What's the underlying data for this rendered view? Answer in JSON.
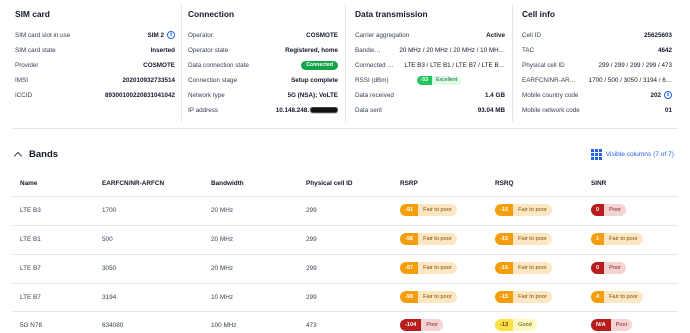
{
  "sim_card": {
    "title": "SIM card",
    "rows": [
      {
        "label": "SIM card slot in use",
        "value": "SIM 2"
      },
      {
        "label": "SIM card state",
        "value": "Inserted"
      },
      {
        "label": "Provider",
        "value": "COSMOTE"
      },
      {
        "label": "IMSI",
        "value": "202010932733514"
      },
      {
        "label": "ICCID",
        "value": "89300100220831041042"
      }
    ]
  },
  "connection": {
    "title": "Connection",
    "rows": [
      {
        "label": "Operator",
        "value": "COSMOTE"
      },
      {
        "label": "Operator state",
        "value": "Registered, home"
      },
      {
        "label": "Data connection state",
        "value": "Connected"
      },
      {
        "label": "Connection stage",
        "value": "Setup complete"
      },
      {
        "label": "Network type",
        "value": "5G (NSA); VoLTE"
      },
      {
        "label": "IP address",
        "value": "10.148.248."
      }
    ]
  },
  "data_transmission": {
    "title": "Data transmission",
    "rows": [
      {
        "label": "Carrier aggregation",
        "value": "Active"
      },
      {
        "label": "Bandw…",
        "value": "20 MHz / 20 MHz / 20 MHz / 10 MH…"
      },
      {
        "label": "Connected …",
        "value": "LTE B3 / LTE B1 / LTE B7 / LTE B…"
      },
      {
        "label": "RSSI (dBm)",
        "value": "-53",
        "quality": "Excellent"
      },
      {
        "label": "Data received",
        "value": "1.4 GB"
      },
      {
        "label": "Data sent",
        "value": "93.04 MB"
      }
    ]
  },
  "cell_info": {
    "title": "Cell info",
    "rows": [
      {
        "label": "Cell ID",
        "value": "25625603"
      },
      {
        "label": "TAC",
        "value": "4642"
      },
      {
        "label": "Physical cell ID",
        "value": "299 / 299 / 299 / 299 / 473"
      },
      {
        "label": "EARFCN/NR-AR…",
        "value": "1700 / 500 / 3050 / 3194 / 6…"
      },
      {
        "label": "Mobile country code",
        "value": "202"
      },
      {
        "label": "Mobile network code",
        "value": "01"
      }
    ]
  },
  "bands": {
    "title": "Bands",
    "visible_columns_label": "Visible columns (7 of 7)",
    "columns": [
      "Name",
      "EARFCN/NR-ARFCN",
      "Bandwidth",
      "Physical cell ID",
      "RSRP",
      "RSRQ",
      "SINR"
    ],
    "rows": [
      {
        "name": "LTE B3",
        "earfcn": "1700",
        "bw": "20 MHz",
        "pci": "299",
        "rsrp": "-91",
        "rsrp_q": "Fair to poor",
        "rsrq": "-15",
        "rsrq_q": "Fair to poor",
        "sinr": "0",
        "sinr_q": "Poor"
      },
      {
        "name": "LTE B1",
        "earfcn": "500",
        "bw": "20 MHz",
        "pci": "299",
        "rsrp": "-96",
        "rsrp_q": "Fair to poor",
        "rsrq": "-15",
        "rsrq_q": "Fair to poor",
        "sinr": "1",
        "sinr_q": "Fair to poor"
      },
      {
        "name": "LTE B7",
        "earfcn": "3050",
        "bw": "20 MHz",
        "pci": "299",
        "rsrp": "-97",
        "rsrp_q": "Fair to poor",
        "rsrq": "-16",
        "rsrq_q": "Fair to poor",
        "sinr": "0",
        "sinr_q": "Poor"
      },
      {
        "name": "LTE B7",
        "earfcn": "3194",
        "bw": "10 MHz",
        "pci": "299",
        "rsrp": "-98",
        "rsrp_q": "Fair to poor",
        "rsrq": "-15",
        "rsrq_q": "Fair to poor",
        "sinr": "4",
        "sinr_q": "Fair to poor"
      },
      {
        "name": "5G N78",
        "earfcn": "634080",
        "bw": "100 MHz",
        "pci": "473",
        "rsrp": "-104",
        "rsrp_q": "Poor",
        "rsrq": "-13",
        "rsrq_q": "Good",
        "sinr": "N/A",
        "sinr_q": "Poor"
      }
    ]
  },
  "colors": {
    "accent": "#2563eb",
    "connected": "#16a34a",
    "excellent": "#22c55e",
    "fair_to_poor": "#f59e0b",
    "poor": "#b91c1c",
    "good": "#fde047"
  },
  "icons": {
    "info": "info-icon",
    "collapse": "chevron-up-icon",
    "columns": "grid-icon"
  }
}
